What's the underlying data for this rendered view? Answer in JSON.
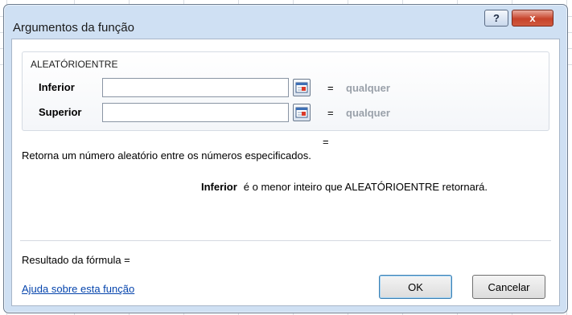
{
  "dialog": {
    "title": "Argumentos da função",
    "help_glyph": "?",
    "close_glyph": "x"
  },
  "function": {
    "name": "ALEATÓRIOENTRE",
    "args": [
      {
        "label": "Inferior",
        "value": "",
        "eq": "=",
        "hint": "qualquer",
        "collapse_icon": "collapse-dialog-icon"
      },
      {
        "label": "Superior",
        "value": "",
        "eq": "=",
        "hint": "qualquer",
        "collapse_icon": "collapse-dialog-icon"
      }
    ],
    "result_eq": "=",
    "description": "Retorna um número aleatório entre os números especificados.",
    "arg_description_name": "Inferior",
    "arg_description_text": "é o menor inteiro que ALEATÓRIOENTRE retornará."
  },
  "footer": {
    "result_label": "Resultado da fórmula =",
    "help_link": "Ajuda sobre esta função",
    "ok_label": "OK",
    "cancel_label": "Cancelar"
  },
  "colors": {
    "frame": "#cfe0f3",
    "close_button": "#c7432a",
    "link": "#0645ad",
    "hint_gray": "#9aa1aa"
  }
}
